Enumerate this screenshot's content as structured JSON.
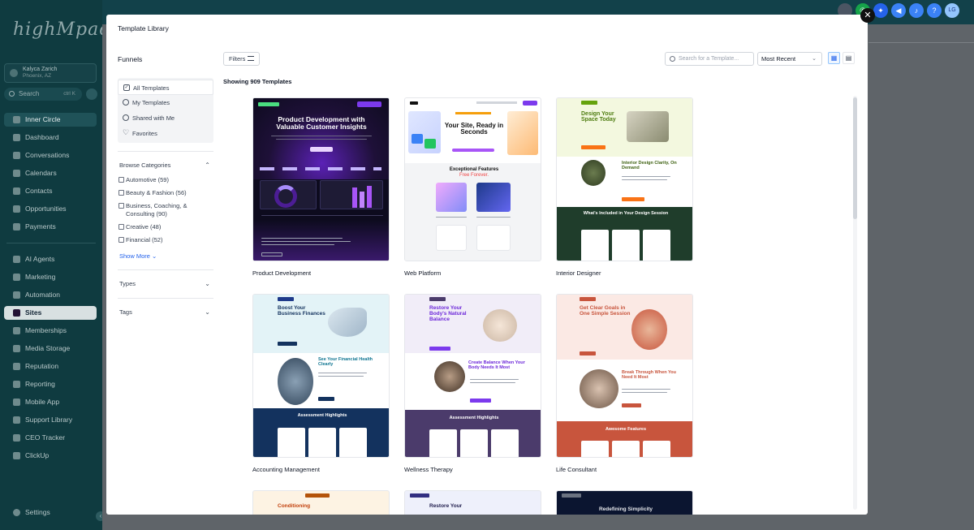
{
  "sidebar": {
    "logo": "highMpact",
    "account_name": "Kalyca Zarich",
    "account_location": "Phoenix, AZ",
    "search_label": "Search",
    "search_shortcut": "ctrl K",
    "items": [
      {
        "label": "Inner Circle"
      },
      {
        "label": "Dashboard"
      },
      {
        "label": "Conversations"
      },
      {
        "label": "Calendars"
      },
      {
        "label": "Contacts"
      },
      {
        "label": "Opportunities"
      },
      {
        "label": "Payments"
      },
      {
        "label": "AI Agents"
      },
      {
        "label": "Marketing"
      },
      {
        "label": "Automation"
      },
      {
        "label": "Sites"
      },
      {
        "label": "Memberships"
      },
      {
        "label": "Media Storage"
      },
      {
        "label": "Reputation"
      },
      {
        "label": "Reporting"
      },
      {
        "label": "Mobile App"
      },
      {
        "label": "Support Library"
      },
      {
        "label": "CEO Tracker"
      },
      {
        "label": "ClickUp"
      },
      {
        "label": "Settings"
      }
    ]
  },
  "topbar": {
    "initials": "LG"
  },
  "modal": {
    "title": "Template Library",
    "panel_title": "Funnels",
    "filters_label": "Filters",
    "search_placeholder": "Search for a Template...",
    "sort_value": "Most Recent",
    "showing_text": "Showing 909 Templates",
    "nav": [
      {
        "label": "All Templates"
      },
      {
        "label": "My Templates"
      },
      {
        "label": "Shared with Me"
      },
      {
        "label": "Favorites"
      }
    ],
    "browse_categories_label": "Browse Categories",
    "categories": [
      {
        "label": "Automotive (59)"
      },
      {
        "label": "Beauty & Fashion (56)"
      },
      {
        "label": "Business, Coaching, & Consulting (90)"
      },
      {
        "label": "Creative (48)"
      },
      {
        "label": "Financial (52)"
      }
    ],
    "show_more_label": "Show More",
    "types_label": "Types",
    "tags_label": "Tags"
  },
  "templates": [
    {
      "name": "Product Development",
      "headline": "Product Development with Valuable Customer Insights"
    },
    {
      "name": "Web Platform",
      "headline": "Your Site, Ready in Seconds",
      "sub": "Exceptional Features",
      "sub2": "Free Forever."
    },
    {
      "name": "Interior Designer",
      "headline": "Design Your Space Today",
      "sub": "Interior Design Clarity, On Demand",
      "sub2": "What's Included in Your Design Session"
    },
    {
      "name": "Accounting Management",
      "headline": "Boost Your Business Finances",
      "sub": "See Your Financial Health Clearly",
      "sub2": "Assessment Highlights"
    },
    {
      "name": "Wellness Therapy",
      "headline": "Restore Your Body's Natural Balance",
      "sub": "Create Balance When Your Body Needs It Most",
      "sub2": "Assessment Highlights"
    },
    {
      "name": "Life Consultant",
      "headline": "Get Clear Goals in One Simple Session",
      "sub": "Break Through When You Need It Most",
      "sub2": "Awesome Features"
    },
    {
      "name": "",
      "headline": "Conditioning"
    },
    {
      "name": "",
      "headline": "Restore Your"
    },
    {
      "name": "",
      "headline": "Redefining Simplicity"
    }
  ],
  "colors": {
    "sidebar_bg": "#0f3b40",
    "accent_blue": "#2563eb",
    "interior_green": "#1f3d2b",
    "accounting_navy": "#13325e",
    "wellness_purple": "#4b3b6b",
    "consultant_red": "#c8553d"
  },
  "icons": [
    "search-icon",
    "close-icon",
    "filter-icon",
    "grid-view-icon",
    "list-view-icon",
    "chevron-down-icon",
    "phone-icon",
    "megaphone-icon",
    "bell-icon",
    "help-icon"
  ]
}
